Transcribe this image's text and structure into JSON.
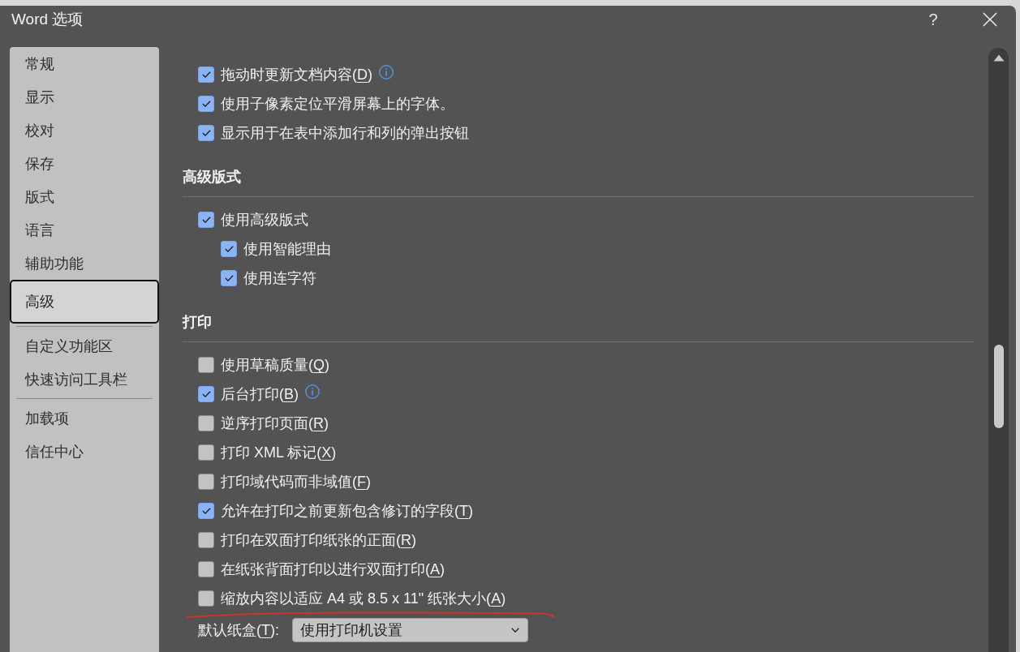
{
  "window": {
    "title": "Word 选项",
    "help": "?"
  },
  "sidebar": {
    "groups": [
      {
        "items": [
          {
            "label": "常规",
            "selected": false
          },
          {
            "label": "显示",
            "selected": false
          },
          {
            "label": "校对",
            "selected": false
          },
          {
            "label": "保存",
            "selected": false
          },
          {
            "label": "版式",
            "selected": false
          },
          {
            "label": "语言",
            "selected": false
          },
          {
            "label": "辅助功能",
            "selected": false
          },
          {
            "label": "高级",
            "selected": true
          }
        ]
      },
      {
        "items": [
          {
            "label": "自定义功能区",
            "selected": false
          },
          {
            "label": "快速访问工具栏",
            "selected": false
          }
        ]
      },
      {
        "items": [
          {
            "label": "加载项",
            "selected": false
          },
          {
            "label": "信任中心",
            "selected": false
          }
        ]
      }
    ]
  },
  "sections": [
    {
      "options": [
        {
          "label": "拖动时更新文档内容(",
          "access_key": "D",
          "label_end": ")",
          "checked": true,
          "info": true
        },
        {
          "label": "使用子像素定位平滑屏幕上的字体。",
          "checked": true,
          "info": false
        },
        {
          "label": "显示用于在表中添加行和列的弹出按钮",
          "checked": true,
          "info": false
        }
      ]
    },
    {
      "heading": "高级版式",
      "options": [
        {
          "label": "使用高级版式",
          "checked": true,
          "info": false,
          "children": [
            {
              "label": "使用智能理由",
              "checked": true,
              "info": false
            },
            {
              "label": "使用连字符",
              "checked": true,
              "info": false
            }
          ]
        }
      ]
    },
    {
      "heading": "打印",
      "options": [
        {
          "label": "使用草稿质量(",
          "access_key": "Q",
          "label_end": ")",
          "checked": false,
          "info": false
        },
        {
          "label": "后台打印(",
          "access_key": "B",
          "label_end": ")",
          "checked": true,
          "info": true
        },
        {
          "label": "逆序打印页面(",
          "access_key": "R",
          "label_end": ")",
          "checked": false,
          "info": false
        },
        {
          "label": "打印 XML 标记(",
          "access_key": "X",
          "label_end": ")",
          "checked": false,
          "info": false
        },
        {
          "label": "打印域代码而非域值(",
          "access_key": "F",
          "label_end": ")",
          "checked": false,
          "info": false
        },
        {
          "label": "允许在打印之前更新包含修订的字段(",
          "access_key": "T",
          "label_end": ")",
          "checked": true,
          "info": false
        },
        {
          "label": "打印在双面打印纸张的正面(",
          "access_key": "R",
          "label_end": ")",
          "checked": false,
          "info": false
        },
        {
          "label": "在纸张背面打印以进行双面打印(",
          "access_key": "A",
          "label_end": ")",
          "checked": false,
          "info": false
        },
        {
          "label": "缩放内容以适应 A4 或 8.5 x 11\" 纸张大小(",
          "access_key": "A",
          "label_end": ")",
          "checked": false,
          "info": false
        }
      ],
      "fields": [
        {
          "label": "默认纸盒(",
          "access_key": "T",
          "label_end": "):",
          "value": "使用打印机设置"
        }
      ]
    }
  ]
}
